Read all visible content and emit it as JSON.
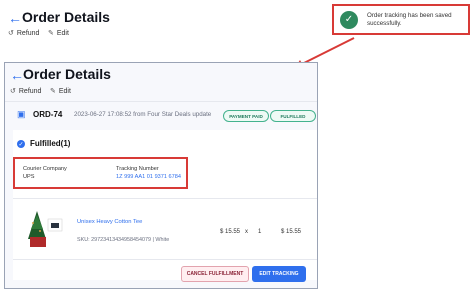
{
  "top": {
    "back_icon": "←",
    "title": "Order Details",
    "refund_label": "Refund",
    "edit_label": "Edit"
  },
  "toast": {
    "icon": "✓",
    "message": "Order tracking has been saved successfully."
  },
  "panel": {
    "back_icon": "←",
    "title": "Order Details",
    "refund_label": "Refund",
    "edit_label": "Edit",
    "order_id": "ORD-74",
    "order_meta": "2023-06-27 17:08:52 from Four Star Deals update",
    "badges": {
      "payment": "PAYMENT PAID",
      "fulfillment": "FULFILLED"
    },
    "fulfilled_title": "Fulfilled(1)",
    "tracking": {
      "courier_label": "Courier Company",
      "courier_value": "UPS",
      "number_label": "Tracking Number",
      "number_value": "1Z 999 AA1 01 9371 6784"
    },
    "product": {
      "name": "Unisex Heavy Cotton Tee",
      "sku_line": "SKU: 29723413434958454079 | White",
      "price": "$ 15.55",
      "times": "x",
      "qty": "1",
      "total": "$ 15.55"
    },
    "buttons": {
      "cancel": "CANCEL FULFILLMENT",
      "edit": "EDIT TRACKING"
    }
  },
  "colors": {
    "accent": "#2f6fed",
    "highlight": "#d83a36",
    "success": "#2f8a5f"
  }
}
